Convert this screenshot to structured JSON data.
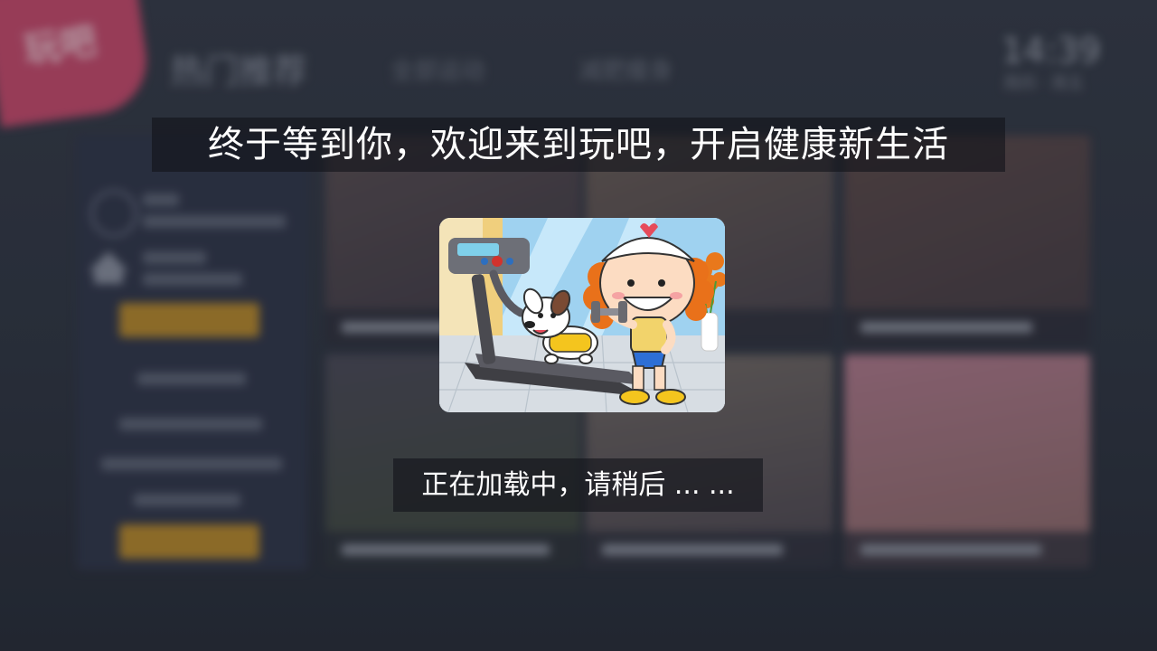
{
  "background_app": {
    "logo_text": "玩吧",
    "page_title": "热门推荐",
    "tabs": [
      "全部运动",
      "减肥瘦身"
    ],
    "clock": "14:39",
    "date": "周四 · 周五"
  },
  "splash": {
    "welcome_message": "终于等到你，欢迎来到玩吧，开启健康新生活",
    "loading_message": "正在加载中，请稍后 ... ..."
  },
  "colors": {
    "accent_gold": "#b98a2c",
    "logo_pink": "#c94a6d",
    "overlay_text": "#ffffff"
  },
  "icons": {
    "illustration": "treadmill-girl-dog-illustration"
  }
}
